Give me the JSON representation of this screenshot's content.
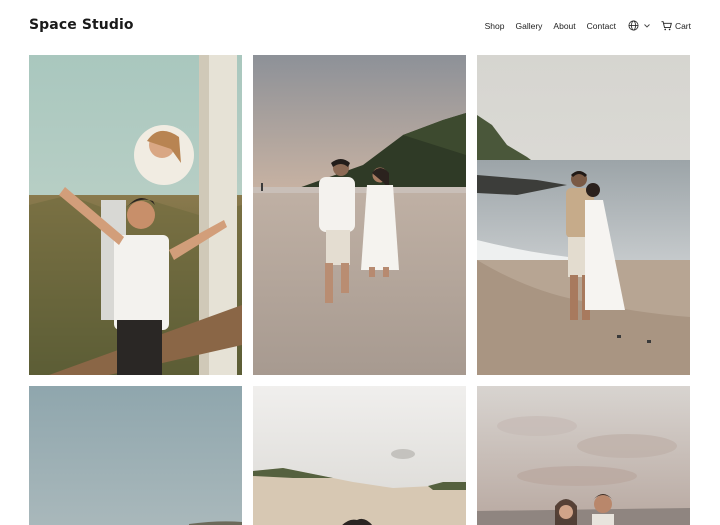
{
  "site": {
    "title": "Space Studio"
  },
  "nav": {
    "items": [
      {
        "label": "Shop"
      },
      {
        "label": "Gallery"
      },
      {
        "label": "About"
      },
      {
        "label": "Contact"
      }
    ],
    "language_icon": "globe-icon",
    "cart": {
      "label": "Cart",
      "icon": "cart-icon"
    }
  },
  "gallery": {
    "photos": [
      {
        "subject": "couple posing by wooden post in tall grass"
      },
      {
        "subject": "couple holding hands on beach at sunset"
      },
      {
        "subject": "couple embracing on shoreline"
      },
      {
        "subject": "sky over field"
      },
      {
        "subject": "sand dunes under bright sky"
      },
      {
        "subject": "couple at beach under cloudy sky"
      }
    ]
  },
  "colors": {
    "background": "#ffffff",
    "text": "#1a1a1a"
  }
}
